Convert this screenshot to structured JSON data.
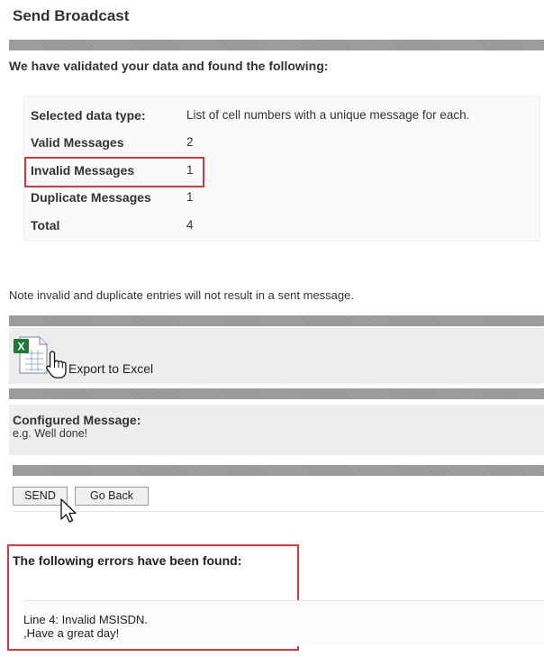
{
  "page": {
    "title": "Send Broadcast"
  },
  "validation": {
    "heading": "We have validated your data and found the following:",
    "rows": [
      {
        "label": "Selected data type:",
        "value": "List of cell numbers with a unique message for each."
      },
      {
        "label": "Valid Messages",
        "value": "2"
      },
      {
        "label": "Invalid Messages",
        "value": "1"
      },
      {
        "label": "Duplicate Messages",
        "value": "1"
      },
      {
        "label": "Total",
        "value": "4"
      }
    ],
    "note": "Note invalid and duplicate entries will not result in a sent message."
  },
  "export": {
    "label": "Export to Excel",
    "icon": "excel-icon"
  },
  "configured": {
    "title": "Configured Message:",
    "text": "e.g. Well done!"
  },
  "actions": {
    "send_label": "SEND",
    "back_label": "Go Back"
  },
  "errors": {
    "heading": "The following errors have been found:",
    "lines": [
      "Line 4: Invalid MSISDN.",
      ",Have a great day!"
    ]
  },
  "colors": {
    "highlight": "#d9383e",
    "excel_green": "#1f7a3a"
  }
}
